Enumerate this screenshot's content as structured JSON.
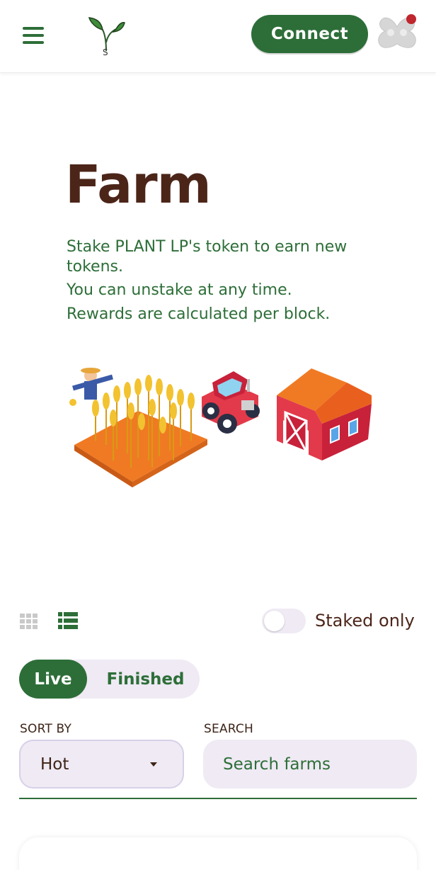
{
  "header": {
    "connect_label": "Connect",
    "logo_letter": "S"
  },
  "hero": {
    "title": "Farm",
    "description_line1": "Stake PLANT LP's token to earn new tokens.",
    "description_line2": "You can unstake at any time.",
    "description_line3": "Rewards are calculated per block."
  },
  "controls": {
    "staked_only_label": "Staked only",
    "staked_only_checked": false,
    "view_mode": "list"
  },
  "tabs": [
    {
      "label": "Live",
      "active": true
    },
    {
      "label": "Finished",
      "active": false
    }
  ],
  "sort": {
    "label": "SORT BY",
    "value": "Hot"
  },
  "search": {
    "label": "SEARCH",
    "placeholder": "Search farms"
  },
  "colors": {
    "brand_green": "#2d6e38",
    "title_brown": "#4c2519",
    "pill_bg": "#efeaf4",
    "notification_red": "#c0262d"
  },
  "icons": [
    "menu-icon",
    "plant-logo-icon",
    "profile-avatar-icon",
    "grid-view-icon",
    "list-view-icon",
    "sort-caret-icon"
  ]
}
